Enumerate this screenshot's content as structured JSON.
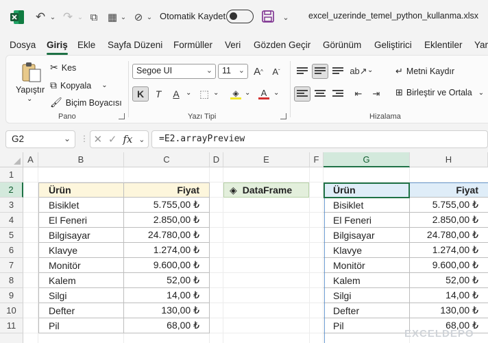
{
  "titlebar": {
    "autosave_label": "Otomatik Kaydet",
    "filename": "excel_uzerinde_temel_python_kullanma.xlsx"
  },
  "menu": [
    "Dosya",
    "Giriş",
    "Ekle",
    "Sayfa Düzeni",
    "Formüller",
    "Veri",
    "Gözden Geçir",
    "Görünüm",
    "Geliştirici",
    "Eklentiler",
    "Yar"
  ],
  "ribbon": {
    "clipboard": {
      "paste": "Yapıştır",
      "cut": "Kes",
      "copy": "Kopyala",
      "format_painter": "Biçim Boyacısı",
      "label": "Pano"
    },
    "font": {
      "name": "Segoe UI",
      "size": "11",
      "bold": "K",
      "italic": "T",
      "underline": "A",
      "label": "Yazı Tipi",
      "fill_color": "#f3e82a",
      "font_color": "#d32f2f"
    },
    "alignment": {
      "wrap_text": "Metni Kaydır",
      "merge_center": "Birleştir ve Ortala",
      "label": "Hizalama"
    }
  },
  "formula_bar": {
    "name_box": "G2",
    "formula": "=E2.arrayPreview"
  },
  "columns": [
    "A",
    "B",
    "C",
    "D",
    "E",
    "F",
    "G",
    "H"
  ],
  "rows": [
    "1",
    "2",
    "3",
    "4",
    "5",
    "6",
    "7",
    "8",
    "9",
    "10",
    "11"
  ],
  "table": {
    "headers": [
      "Ürün",
      "Fiyat"
    ],
    "rows": [
      [
        "Bisiklet",
        "5.755,00 ₺"
      ],
      [
        "El Feneri",
        "2.850,00 ₺"
      ],
      [
        "Bilgisayar",
        "24.780,00 ₺"
      ],
      [
        "Klavye",
        "1.274,00 ₺"
      ],
      [
        "Monitör",
        "9.600,00 ₺"
      ],
      [
        "Kalem",
        "52,00 ₺"
      ],
      [
        "Silgi",
        "14,00 ₺"
      ],
      [
        "Defter",
        "130,00 ₺"
      ],
      [
        "Pil",
        "68,00 ₺"
      ]
    ]
  },
  "dataframe_chip": "DataFrame",
  "watermark": "EXCELDEPO"
}
